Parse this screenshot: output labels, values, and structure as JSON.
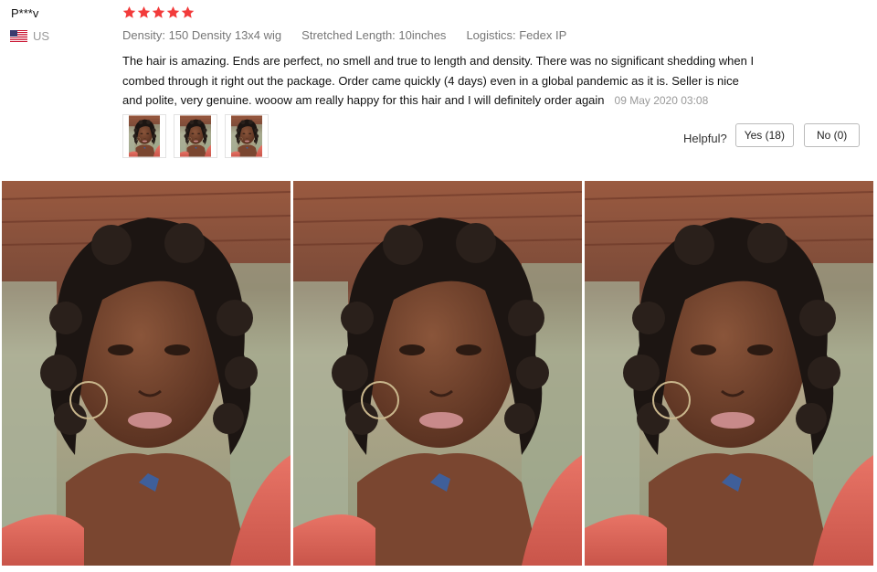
{
  "review": {
    "reviewer": "P***v",
    "country": "US",
    "rating": 5,
    "attributes": [
      "Density: 150 Density 13x4 wig",
      "Stretched Length: 10inches",
      "Logistics: Fedex IP"
    ],
    "text": "The hair is amazing. Ends are perfect, no smell and true to length and density. There was no significant shedding when I combed through it right out the package. Order came quickly (4 days) even in a global pandemic as it is. Seller is nice and polite, very genuine. wooow am really happy for this hair and I will definitely order again",
    "date": "09 May 2020 03:08",
    "thumbnail_count": 3
  },
  "helpful": {
    "label": "Helpful?",
    "yes_label": "Yes (18)",
    "no_label": "No (0)"
  },
  "colors": {
    "star": "#f23b3b",
    "muted_text": "#777777",
    "border": "#bbbbbb",
    "shirt": "#e4685c",
    "skin": "#6e3f2a",
    "hair": "#1c1512",
    "brick": "#8a4a36"
  },
  "icons": {
    "flag": "us-flag-icon",
    "star": "star-icon"
  }
}
